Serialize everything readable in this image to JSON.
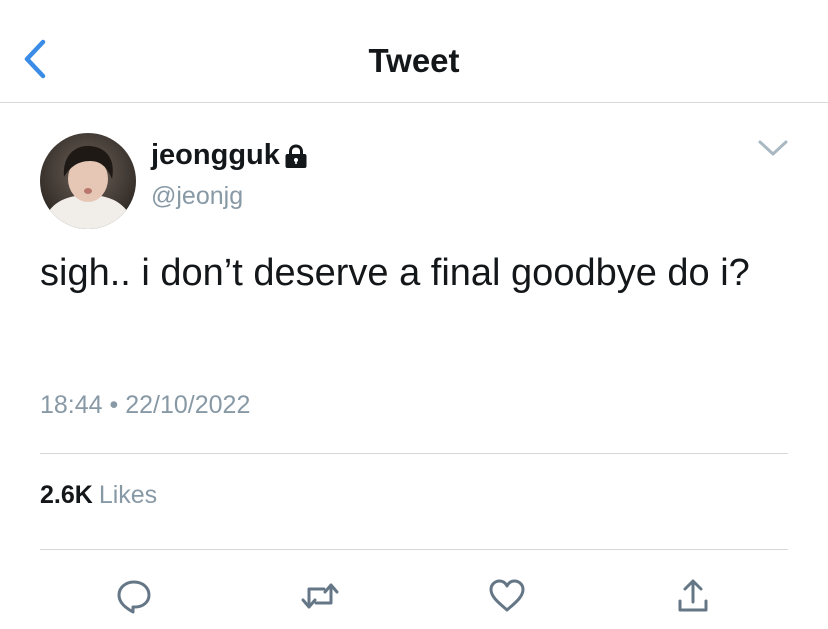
{
  "header": {
    "title": "Tweet",
    "back_icon": "chevron-left-icon",
    "accent_color": "#3a8ce6"
  },
  "tweet": {
    "author": {
      "display_name": "jeongguk",
      "handle": "@jeonjg",
      "protected_icon": "lock-icon",
      "avatar_icon": "avatar"
    },
    "text": "sigh.. i don’t deserve a final goodbye do i?",
    "time": "18:44",
    "separator": "•",
    "date": "22/10/2022",
    "likes": {
      "count": "2.6K",
      "label": "Likes"
    },
    "menu_icon": "chevron-down-icon"
  },
  "actions": [
    {
      "name": "reply",
      "icon": "speech-bubble-icon"
    },
    {
      "name": "retweet",
      "icon": "retweet-icon"
    },
    {
      "name": "like",
      "icon": "heart-icon"
    },
    {
      "name": "share",
      "icon": "share-icon"
    }
  ],
  "colors": {
    "text_primary": "#14171a",
    "text_secondary": "#8899a6",
    "divider": "#d6d9dc",
    "icon_gray": "#657786"
  }
}
